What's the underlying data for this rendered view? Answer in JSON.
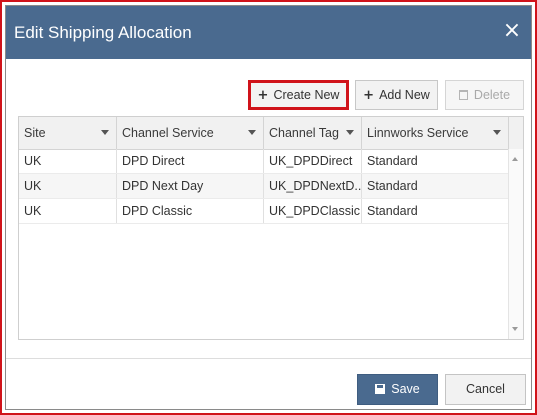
{
  "dialog": {
    "title": "Edit Shipping Allocation",
    "close_glyph": "×"
  },
  "toolbar": {
    "create_new": {
      "icon": "plus-icon",
      "glyph": "+",
      "label": "Create New"
    },
    "add_new": {
      "icon": "plus-icon",
      "glyph": "+",
      "label": "Add New"
    },
    "delete": {
      "icon": "trash-icon",
      "label": "Delete"
    }
  },
  "grid": {
    "columns": [
      "Site",
      "Channel Service",
      "Channel Tag",
      "Linnworks Service"
    ],
    "rows": [
      [
        "UK",
        "DPD Direct",
        "UK_DPDDirect",
        "Standard"
      ],
      [
        "UK",
        "DPD Next Day",
        "UK_DPDNextD...",
        "Standard"
      ],
      [
        "UK",
        "DPD Classic",
        "UK_DPDClassic",
        "Standard"
      ]
    ]
  },
  "footer": {
    "save": {
      "icon": "save-icon",
      "label": "Save"
    },
    "cancel": {
      "label": "Cancel"
    }
  },
  "colors": {
    "titlebar": "#4a6a8f",
    "highlight": "#d0131a",
    "save_button": "#4a6a8f"
  }
}
